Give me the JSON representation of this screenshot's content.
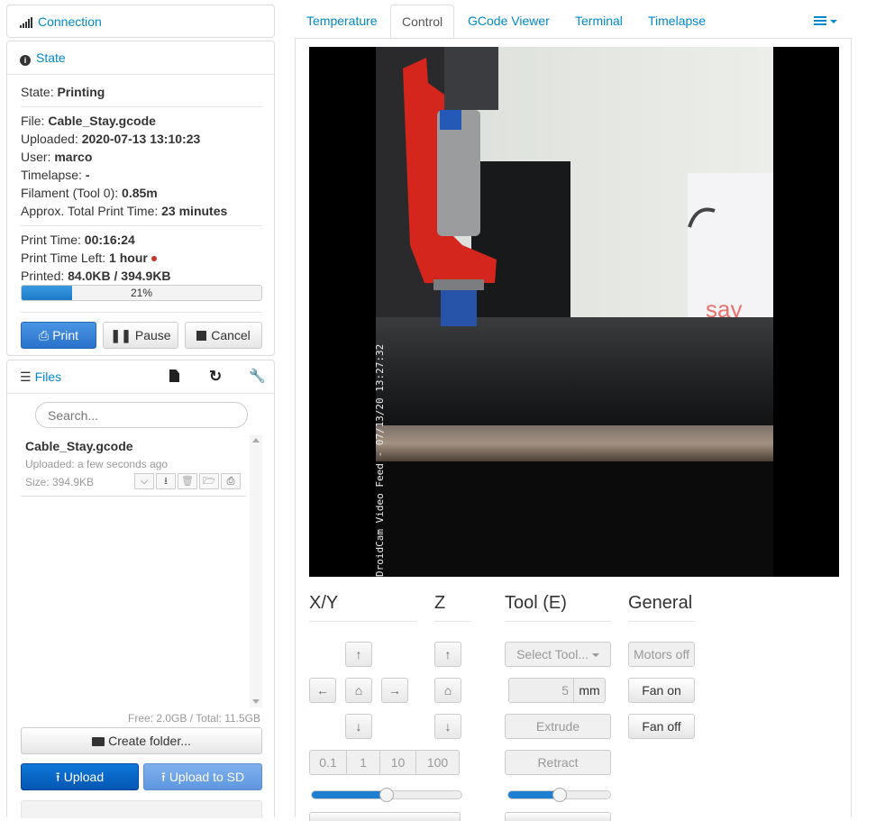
{
  "connection": {
    "label": "Connection"
  },
  "state": {
    "header": "State",
    "state_label": "State: ",
    "state_value": "Printing",
    "file_label": "File: ",
    "file_value": "Cable_Stay.gcode",
    "uploaded_label": "Uploaded: ",
    "uploaded_value": "2020-07-13 13:10:23",
    "user_label": "User: ",
    "user_value": "marco",
    "timelapse_label": "Timelapse: ",
    "timelapse_value": "-",
    "filament_label": "Filament (Tool 0): ",
    "filament_value": "0.85m",
    "approx_label": "Approx. Total Print Time: ",
    "approx_value": "23 minutes",
    "printtime_label": "Print Time: ",
    "printtime_value": "00:16:24",
    "timeleft_label": "Print Time Left: ",
    "timeleft_value": "1 hour",
    "printed_label": "Printed: ",
    "printed_value": "84.0KB / 394.9KB",
    "progress_text": "21%",
    "progress_fraction": 0.21,
    "print_btn": "Print",
    "pause_btn": "Pause",
    "cancel_btn": "Cancel"
  },
  "files": {
    "header": "Files",
    "search_placeholder": "Search...",
    "items": [
      {
        "name": "Cable_Stay.gcode",
        "uploaded": "Uploaded: a few seconds ago",
        "size": "Size: 394.9KB"
      }
    ],
    "storage": "Free: 2.0GB / Total: 11.5GB",
    "create_folder": "Create folder...",
    "upload": "Upload",
    "upload_sd": "Upload to SD"
  },
  "tabs": [
    "Temperature",
    "Control",
    "GCode Viewer",
    "Terminal",
    "Timelapse"
  ],
  "webcam": {
    "overlay": "DroidCam Video Feed - 07/13/20 13:27:32",
    "sign_text": "say"
  },
  "control": {
    "xy_title": "X/Y",
    "z_title": "Z",
    "tool_title": "Tool (E)",
    "general_title": "General",
    "steps": [
      "0.1",
      "1",
      "10",
      "100"
    ],
    "select_tool": "Select Tool...",
    "extrude_amount": "5",
    "extrude_unit": "mm",
    "extrude": "Extrude",
    "retract": "Retract",
    "motors_off": "Motors off",
    "fan_on": "Fan on",
    "fan_off": "Fan off",
    "feedrate_level": 0.5,
    "flowrate_level": 0.5
  },
  "colors": {
    "accent": "#0088cc",
    "progress": "#1c7bc8",
    "primary": "#2a72cc"
  }
}
